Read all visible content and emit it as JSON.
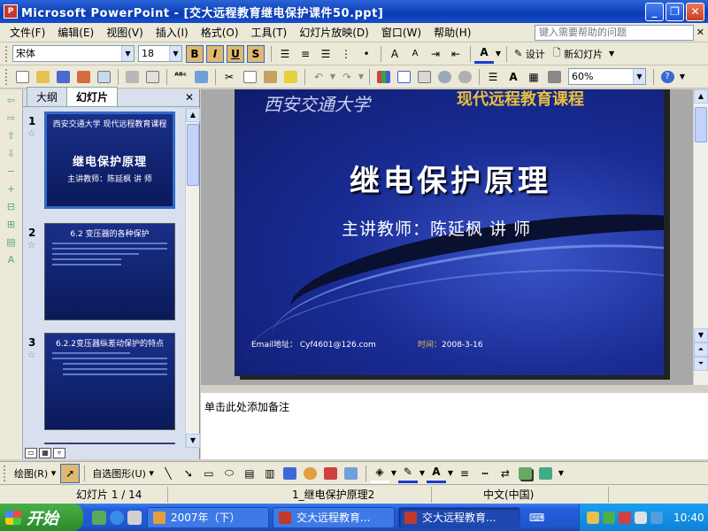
{
  "window": {
    "title": "Microsoft PowerPoint - [交大远程教育继电保护课件50.ppt]",
    "app_icon_label": "P"
  },
  "menu": {
    "items": [
      "文件(F)",
      "编辑(E)",
      "视图(V)",
      "插入(I)",
      "格式(O)",
      "工具(T)",
      "幻灯片放映(D)",
      "窗口(W)",
      "帮助(H)"
    ],
    "help_placeholder": "键入需要帮助的问题"
  },
  "format_toolbar": {
    "font": "宋体",
    "size": "18",
    "bold": "B",
    "italic": "I",
    "underline": "U",
    "shadow": "S",
    "design_label": "设计",
    "new_slide_label": "新幻灯片"
  },
  "standard_toolbar": {
    "zoom": "60%"
  },
  "outline_panel": {
    "tabs": [
      "大纲",
      "幻灯片"
    ],
    "active_tab": "幻灯片",
    "thumbnails": [
      {
        "number": "1",
        "header": "西安交通大学  现代远程教育课程",
        "title": "继电保护原理",
        "subtitle": "主讲教师：陈延枫  讲 师"
      },
      {
        "number": "2",
        "header": "6.2 变压器的各种保护",
        "title": "",
        "subtitle": ""
      },
      {
        "number": "3",
        "header": "6.2.2变压器纵差动保护的特点",
        "title": "",
        "subtitle": ""
      }
    ]
  },
  "slide": {
    "university": "西安交通大学",
    "course": "现代远程教育课程",
    "title": "继电保护原理",
    "presenter": "主讲教师：陈延枫   讲 师",
    "email": "Email地址：   Cyf4601@126.com",
    "time_label": "时间：",
    "time_value": "2008-3-16"
  },
  "notes": {
    "placeholder": "单击此处添加备注"
  },
  "draw_toolbar": {
    "draw_label": "绘图(R)",
    "autoshape_label": "自选图形(U)"
  },
  "status": {
    "slide_position": "幻灯片 1 / 14",
    "design": "1_继电保护原理2",
    "language": "中文(中国)"
  },
  "taskbar": {
    "start_label": "开始",
    "tasks": [
      "2007年（下）",
      "交大远程教育...",
      "交大远程教育..."
    ],
    "clock": "10:40"
  },
  "colors": {
    "title_bar": "#0a3cb4",
    "slide_bg": "#1a2d96",
    "course_gold": "#e8c040",
    "taskbar": "#245edc",
    "start_green": "#2a8a2a"
  }
}
